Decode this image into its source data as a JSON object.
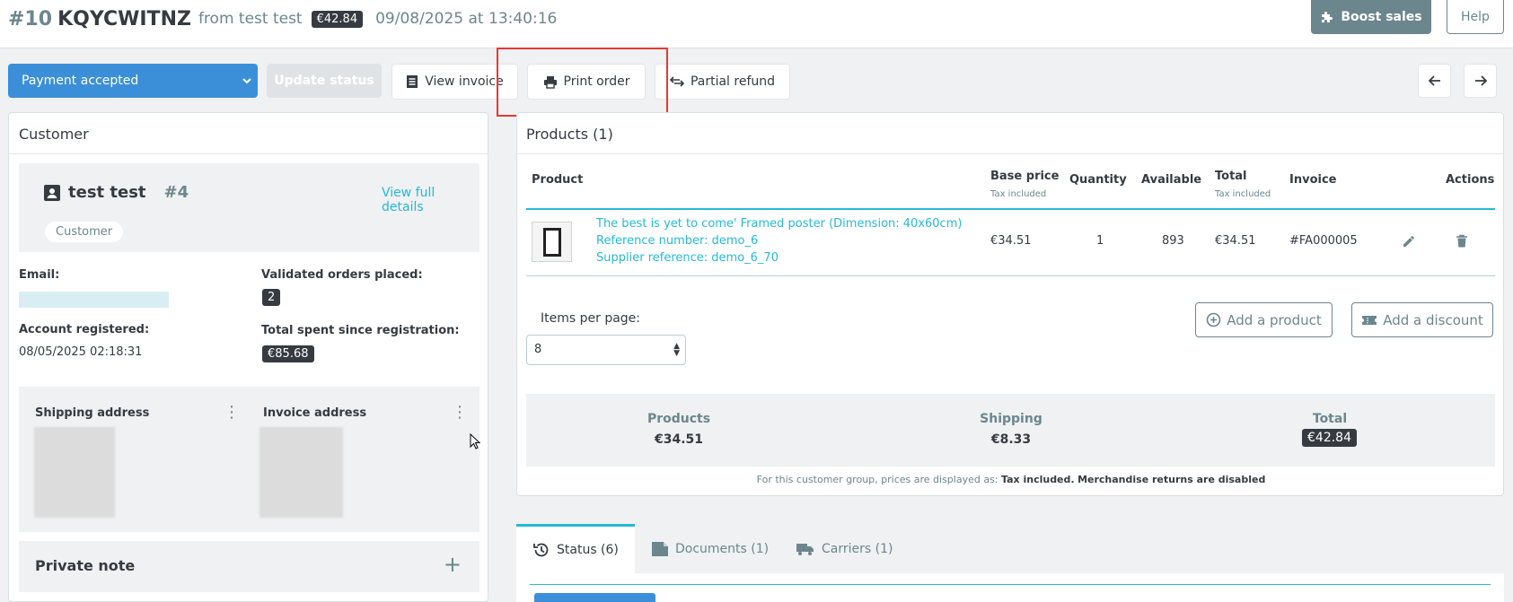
{
  "header": {
    "order_number": "#10",
    "order_reference": "KQYCWITNZ",
    "from_text": "from test test",
    "total_badge": "€42.84",
    "date": "09/08/2025",
    "at_text": "at",
    "time": "13:40:16",
    "boost_label": "Boost sales",
    "help_label": "Help"
  },
  "toolbar": {
    "status_value": "Payment accepted",
    "update_label": "Update status",
    "view_invoice_label": "View invoice",
    "print_order_label": "Print order",
    "partial_refund_label": "Partial refund"
  },
  "customer": {
    "card_title": "Customer",
    "name": "test test",
    "id": "#4",
    "view_full": "View full details",
    "pill": "Customer",
    "email_label": "Email:",
    "validated_label": "Validated orders placed:",
    "validated_value": "2",
    "registered_label": "Account registered:",
    "registered_value": "08/05/2025 02:18:31",
    "total_spent_label": "Total spent since registration:",
    "total_spent_value": "€85.68",
    "shipping_label": "Shipping address",
    "invoice_label": "Invoice address",
    "private_note_label": "Private note"
  },
  "products": {
    "card_title": "Products (1)",
    "columns": {
      "product": "Product",
      "base_price": "Base price",
      "base_price_sub": "Tax included",
      "quantity": "Quantity",
      "available": "Available",
      "total": "Total",
      "total_sub": "Tax included",
      "invoice": "Invoice",
      "actions": "Actions"
    },
    "rows": [
      {
        "name": "The best is yet to come' Framed poster (Dimension: 40x60cm)",
        "reference": "Reference number: demo_6",
        "supplier": "Supplier reference: demo_6_70",
        "base_price": "€34.51",
        "quantity": "1",
        "available": "893",
        "total": "€34.51",
        "invoice": "#FA000005"
      }
    ],
    "items_per_page_label": "Items per page:",
    "items_per_page_value": "8",
    "add_product_label": "Add a product",
    "add_discount_label": "Add a discount",
    "totals": {
      "products_label": "Products",
      "products_value": "€34.51",
      "shipping_label": "Shipping",
      "shipping_value": "€8.33",
      "total_label": "Total",
      "total_value": "€42.84"
    },
    "footnote_prefix": "For this customer group, prices are displayed as:",
    "footnote_tax": "Tax included.",
    "footnote_returns": "Merchandise returns are disabled"
  },
  "tabs": [
    {
      "label": "Status (6)",
      "icon": "history-icon"
    },
    {
      "label": "Documents (1)",
      "icon": "file-icon"
    },
    {
      "label": "Carriers (1)",
      "icon": "truck-icon"
    }
  ],
  "colors": {
    "accent": "#25b9d7",
    "primary_button": "#3b8fd8",
    "dark_badge": "#363a41",
    "highlight": "#e53935"
  }
}
